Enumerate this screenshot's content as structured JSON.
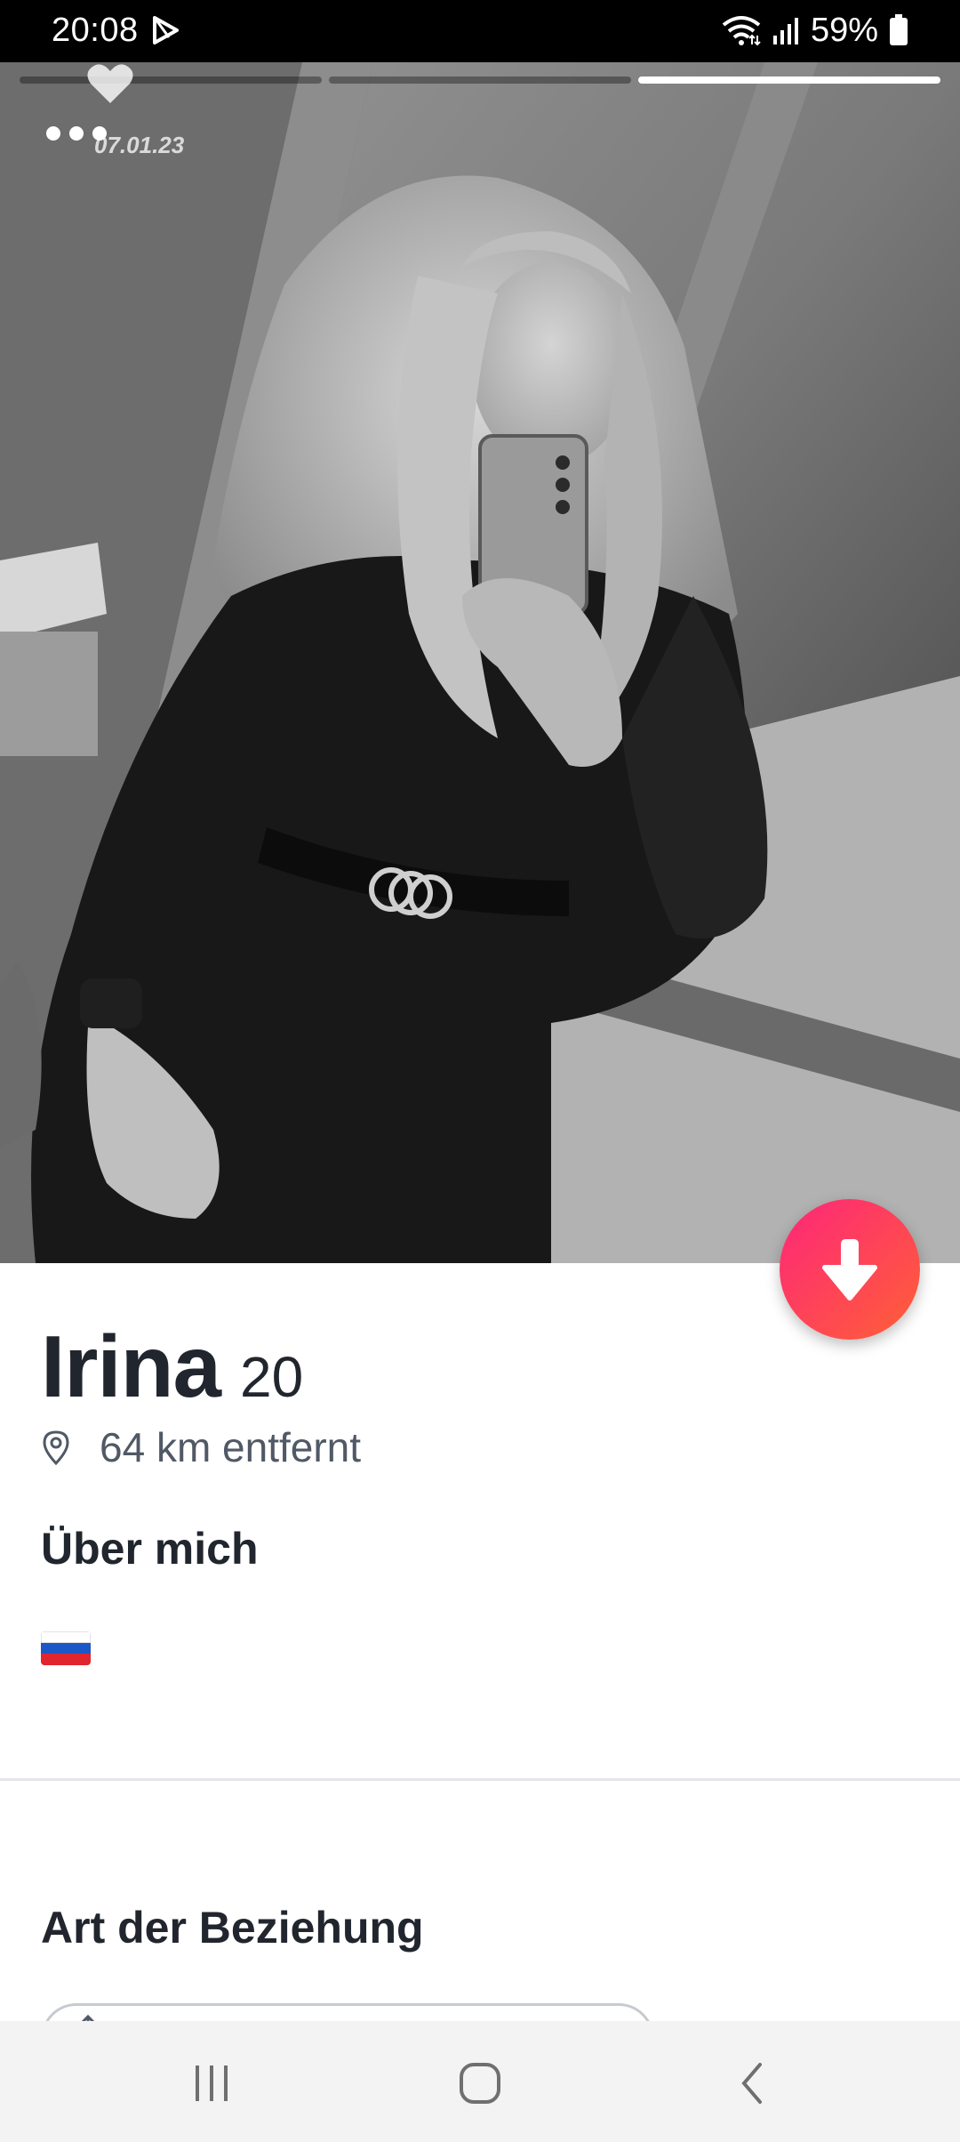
{
  "status_bar": {
    "time": "20:08",
    "battery": "59%",
    "icons": [
      "play-store-icon",
      "wifi-icon",
      "signal-icon",
      "battery-icon"
    ]
  },
  "photo": {
    "progress": {
      "total": 3,
      "active_index": 2
    },
    "date_label": "07.01.23",
    "overlay_icons": [
      "heart-icon",
      "dots-icon"
    ]
  },
  "profile": {
    "name": "Irina",
    "age": "20",
    "distance": "64 km entfernt",
    "about_title": "Über mich",
    "about_flag": "russia-flag-icon",
    "relationship_title": "Art der Beziehung"
  },
  "buttons": {
    "collapse_icon": "arrow-down-icon"
  },
  "colors": {
    "accent_start": "#fd267a",
    "accent_end": "#ff6036",
    "text_primary": "#21262e",
    "text_secondary": "#505965"
  },
  "nav": {
    "items": [
      "recents-icon",
      "home-icon",
      "back-icon"
    ]
  }
}
